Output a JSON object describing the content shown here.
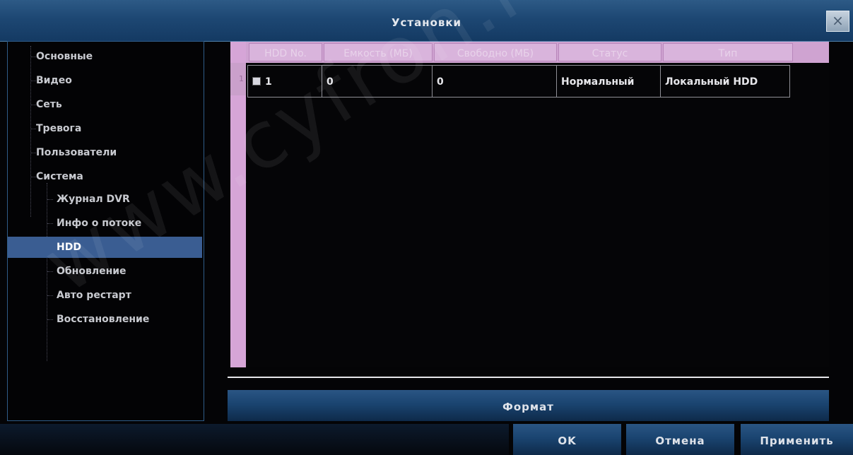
{
  "window": {
    "title": "Установки",
    "close_label": "×"
  },
  "sidebar": {
    "items": [
      {
        "label": "Основные"
      },
      {
        "label": "Видео"
      },
      {
        "label": "Сеть"
      },
      {
        "label": "Тревога"
      },
      {
        "label": "Пользователи"
      },
      {
        "label": "Система"
      }
    ],
    "system_items": [
      {
        "label": "Журнал DVR"
      },
      {
        "label": "Инфо о потоке"
      },
      {
        "label": "HDD",
        "selected": true
      },
      {
        "label": "Обновление"
      },
      {
        "label": "Авто рестарт"
      },
      {
        "label": "Восстановление"
      }
    ]
  },
  "table": {
    "headers": [
      "HDD No.",
      "Емкость (МБ)",
      "Свободно (МБ)",
      "Статус",
      "Тип"
    ],
    "rows": [
      {
        "row_number": "1",
        "hdd_no": "1",
        "checked": true,
        "capacity": "0",
        "free": "0",
        "status": "Нормальный",
        "type": "Локальный HDD"
      }
    ]
  },
  "buttons": {
    "format": "Формат",
    "ok": "OK",
    "cancel": "Отмена",
    "apply": "Применить"
  },
  "watermark": "www.cyfron.ru",
  "colors": {
    "titlebar": "#1d4773",
    "selected_item": "#3a5d92",
    "table_header": "#d9b4dc"
  }
}
